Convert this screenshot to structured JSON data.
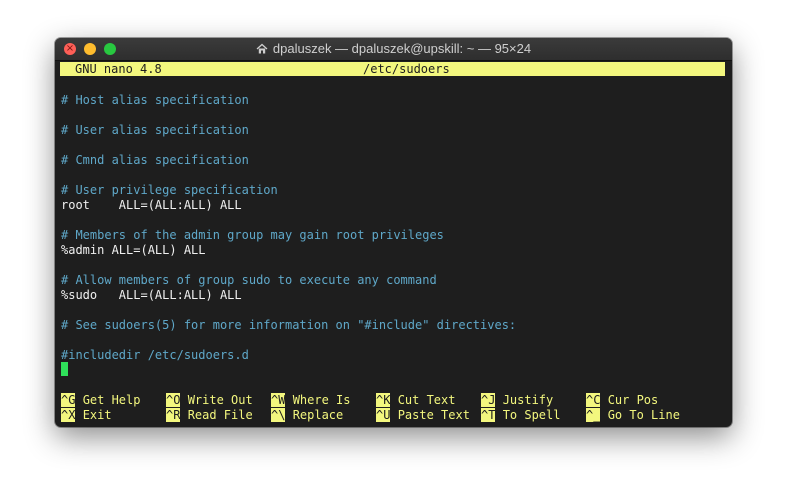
{
  "window": {
    "title": "dpaluszek — dpaluszek@upskill: ~ — 95×24",
    "title_icon": "home-folder-icon",
    "colors": {
      "background": "#1e1e1e",
      "status_bar": "#f3f77e",
      "comment": "#5fa8c9",
      "text": "#f0f0f0",
      "cursor": "#2fe05a"
    }
  },
  "status": {
    "app": "GNU nano 4.8",
    "filename": "/etc/sudoers"
  },
  "content": {
    "lines": [
      "# Host alias specification",
      "# User alias specification",
      "# Cmnd alias specification",
      "# User privilege specification",
      "root    ALL=(ALL:ALL) ALL",
      "# Members of the admin group may gain root privileges",
      "%admin ALL=(ALL) ALL",
      "# Allow members of group sudo to execute any command",
      "%sudo   ALL=(ALL:ALL) ALL",
      "# See sudoers(5) for more information on \"#include\" directives:",
      "#includedir /etc/sudoers.d"
    ]
  },
  "shortcuts": [
    {
      "key": "^G",
      "label": "Get Help"
    },
    {
      "key": "^O",
      "label": "Write Out"
    },
    {
      "key": "^W",
      "label": "Where Is"
    },
    {
      "key": "^K",
      "label": "Cut Text"
    },
    {
      "key": "^J",
      "label": "Justify"
    },
    {
      "key": "^C",
      "label": "Cur Pos"
    },
    {
      "key": "^X",
      "label": "Exit"
    },
    {
      "key": "^R",
      "label": "Read File"
    },
    {
      "key": "^\\",
      "label": "Replace"
    },
    {
      "key": "^U",
      "label": "Paste Text"
    },
    {
      "key": "^T",
      "label": "To Spell"
    },
    {
      "key": "^_",
      "label": "Go To Line"
    }
  ]
}
